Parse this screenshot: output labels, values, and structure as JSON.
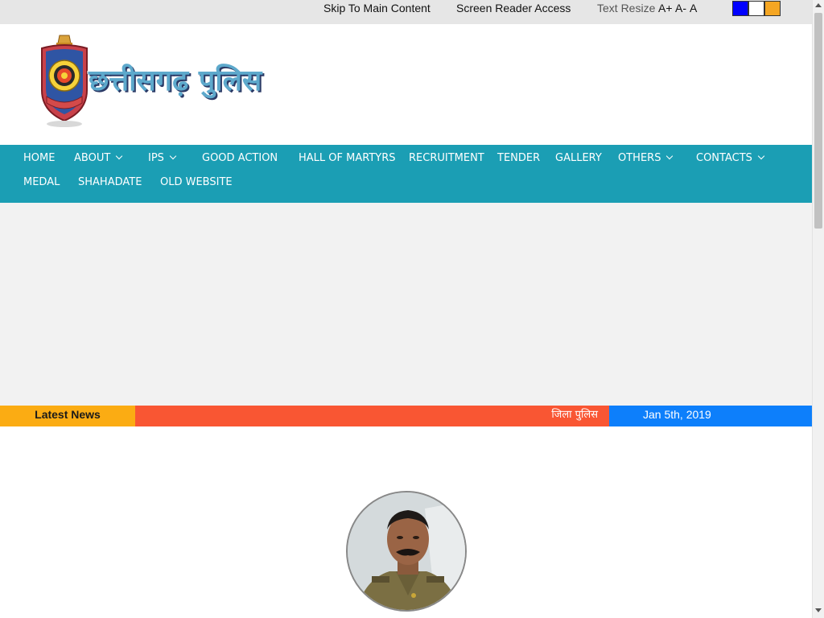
{
  "topbar": {
    "skip_label": "Skip To Main Content",
    "reader_label": "Screen Reader Access",
    "resize_label": "Text Resize",
    "a_plus": "A+",
    "a_minus": "A-",
    "a_normal": "A",
    "themes": [
      {
        "name": "blue-theme",
        "color": "#0000ff"
      },
      {
        "name": "white-theme",
        "color": "#ffffff"
      },
      {
        "name": "orange-theme",
        "color": "#f5a623"
      }
    ]
  },
  "header": {
    "logo_text": "छत्तीसगढ़ पुलिस",
    "emblem_icon": "police-emblem-icon"
  },
  "nav": {
    "items": [
      {
        "label": "HOME",
        "dropdown": false
      },
      {
        "label": "ABOUT",
        "dropdown": true
      },
      {
        "label": "IPS",
        "dropdown": true
      },
      {
        "label": "GOOD ACTION",
        "dropdown": false
      },
      {
        "label": "HALL OF MARTYRS",
        "dropdown": false
      },
      {
        "label": "RECRUITMENT",
        "dropdown": false
      },
      {
        "label": "TENDER",
        "dropdown": false
      },
      {
        "label": "GALLERY",
        "dropdown": false
      },
      {
        "label": "OTHERS",
        "dropdown": true
      },
      {
        "label": "CONTACTS",
        "dropdown": true
      },
      {
        "label": "MEDAL",
        "dropdown": false
      },
      {
        "label": "SHAHADATE",
        "dropdown": false
      },
      {
        "label": "OLD WEBSITE",
        "dropdown": false
      }
    ]
  },
  "ticker": {
    "label": "Latest News",
    "news_text": "जिला पुलिस",
    "date": "Jan 5th, 2019"
  },
  "colors": {
    "nav_bg": "#1b9eb4",
    "ticker_label_bg": "#fbac13",
    "ticker_mid_bg": "#f95633",
    "ticker_date_bg": "#0d7ffb"
  }
}
